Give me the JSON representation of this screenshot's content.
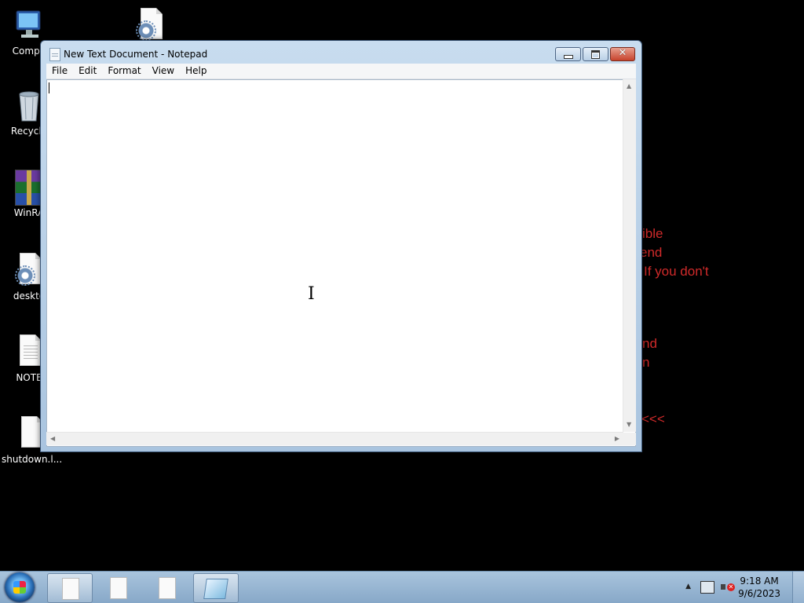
{
  "desktop": {
    "icons": [
      {
        "label": "Compu",
        "icon": "computer-icon"
      },
      {
        "label": "Recycle",
        "icon": "recycle-bin-icon"
      },
      {
        "label": "WinRA",
        "icon": "winrar-icon"
      },
      {
        "label": "deskto",
        "icon": "settings-file-icon"
      },
      {
        "label": "NOTE",
        "icon": "text-file-icon"
      },
      {
        "label": "shutdown.l...",
        "icon": "blank-file-icon"
      },
      {
        "label": "",
        "icon": "settings-file-icon"
      }
    ],
    "background_text": [
      "ible",
      "end",
      "If you don't",
      "nd",
      "n",
      "<<<"
    ],
    "background_text_color": "#d02a2a"
  },
  "notepad": {
    "title": "New Text Document - Notepad",
    "menu": [
      "File",
      "Edit",
      "Format",
      "View",
      "Help"
    ],
    "content": "",
    "close_glyph": "✕"
  },
  "taskbar": {
    "buttons": [
      "document-icon",
      "document-icon",
      "document-icon",
      "notepad-icon"
    ],
    "active_button": 3,
    "tray_arrow": "▲",
    "volume_muted_glyph": "✕",
    "clock": {
      "time": "9:18 AM",
      "date": "9/6/2023"
    }
  }
}
